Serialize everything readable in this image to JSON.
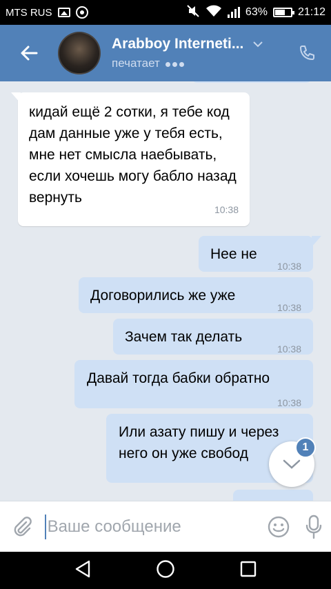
{
  "status_bar": {
    "carrier": "MTS RUS",
    "battery": "63%",
    "battery_level": 0.63,
    "time": "21:12"
  },
  "header": {
    "name": "Arabboy Interneti...",
    "status": "печатает"
  },
  "messages": [
    {
      "direction": "incoming",
      "text": "кидай ещё 2 сотки, я тебе код дам данные уже у тебя есть, мне нет смысла наебывать, если хочешь могу бабло назад вернуть",
      "time": "10:38"
    },
    {
      "direction": "outgoing",
      "text": "Нее не",
      "time": "10:38"
    },
    {
      "direction": "outgoing",
      "text": "Договорились же уже",
      "time": "10:38"
    },
    {
      "direction": "outgoing",
      "text": "Зачем так делать",
      "time": "10:38"
    },
    {
      "direction": "outgoing",
      "text": "Давай тогда бабки обратно",
      "time": "10:38"
    },
    {
      "direction": "outgoing",
      "text": "Или азату пишу и через него он уже свобод",
      "time": ""
    }
  ],
  "unread_badge": "1",
  "compose": {
    "placeholder": "Ваше сообщение"
  },
  "colors": {
    "header": "#5181b8",
    "outgoing_bubble": "#cfe0f5",
    "incoming_bubble": "#ffffff",
    "chat_background": "#e4e9ef"
  }
}
